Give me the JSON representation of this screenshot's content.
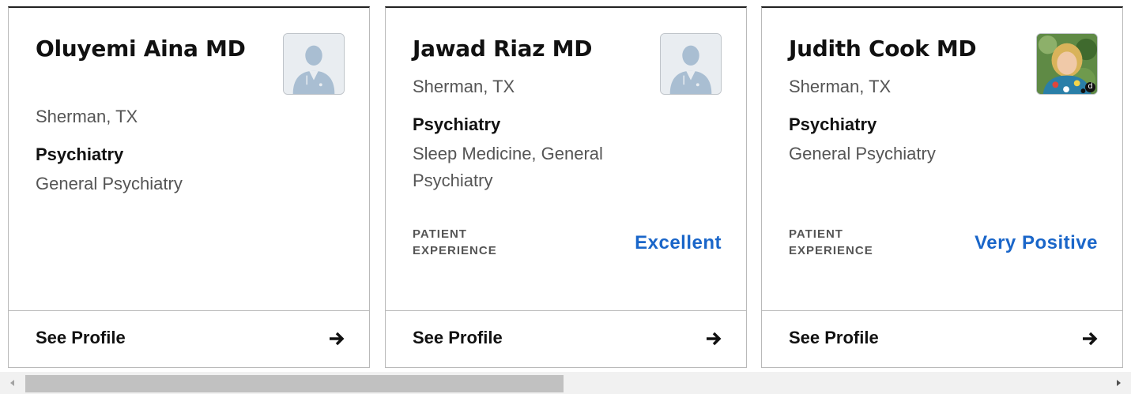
{
  "cards": [
    {
      "name": "Oluyemi Aina MD",
      "location": "Sherman, TX",
      "specialty": "Psychiatry",
      "subspecialties": "General Psychiatry",
      "avatar": "doctor-placeholder-icon",
      "cta": "See Profile"
    },
    {
      "name": "Jawad Riaz MD",
      "location": "Sherman, TX",
      "specialty": "Psychiatry",
      "subspecialties": "Sleep Medicine, General Psychiatry",
      "patient_experience_label": "PATIENT EXPERIENCE",
      "patient_experience_value": "Excellent",
      "avatar": "doctor-placeholder-icon",
      "cta": "See Profile"
    },
    {
      "name": "Judith Cook MD",
      "location": "Sherman, TX",
      "specialty": "Psychiatry",
      "subspecialties": "General Psychiatry",
      "patient_experience_label": "PATIENT EXPERIENCE",
      "patient_experience_value": "Very Positive",
      "avatar": "doctor-photo",
      "badge": "d",
      "cta": "See Profile"
    }
  ],
  "colors": {
    "accent": "#1a66c9",
    "text": "#111111",
    "muted": "#555555",
    "border": "#b9b9b9"
  }
}
